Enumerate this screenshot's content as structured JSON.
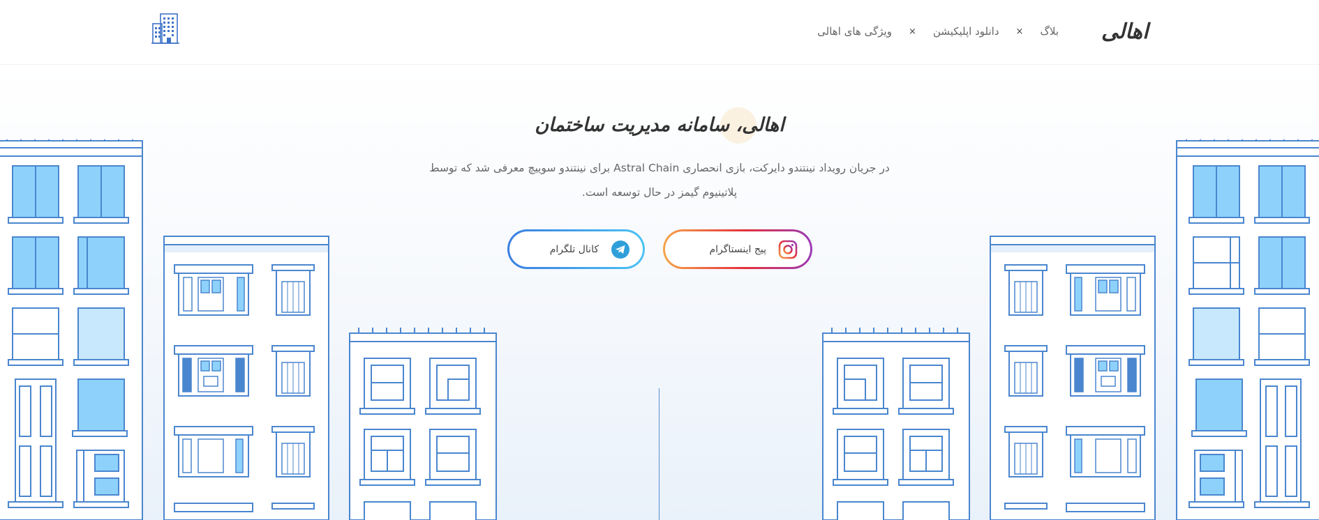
{
  "header": {
    "logo_text": "اهالی",
    "nav": [
      {
        "label": "ویژگی های اهالی"
      },
      {
        "label": "دانلود اپلیکیشن"
      },
      {
        "label": "بلاگ"
      }
    ],
    "separator": "×",
    "building_icon": "building-icon"
  },
  "hero": {
    "title": "اهالی، سامانه مدیریت ساختمان",
    "description": "در جریان رویداد نینتندو دایرکت، بازی انحصاری Astral Chain برای نینتندو سوییچ معرفی شد که توسط پلاتینیوم گیمز در حال توسعه است.",
    "buttons": {
      "instagram": {
        "label": "پیج اینستاگرام",
        "icon": "instagram-icon"
      },
      "telegram": {
        "label": "کانال تلگرام",
        "icon": "telegram-icon"
      }
    }
  },
  "colors": {
    "outline_blue": "#4a86cf",
    "window_blue": "#8ed2fb",
    "window_light": "#c7e8fd",
    "instagram_gradient": [
      "#f5a54a",
      "#e5303c",
      "#9b3bb5"
    ],
    "telegram_gradient": [
      "#3a7ee0",
      "#4cc3f4"
    ]
  }
}
